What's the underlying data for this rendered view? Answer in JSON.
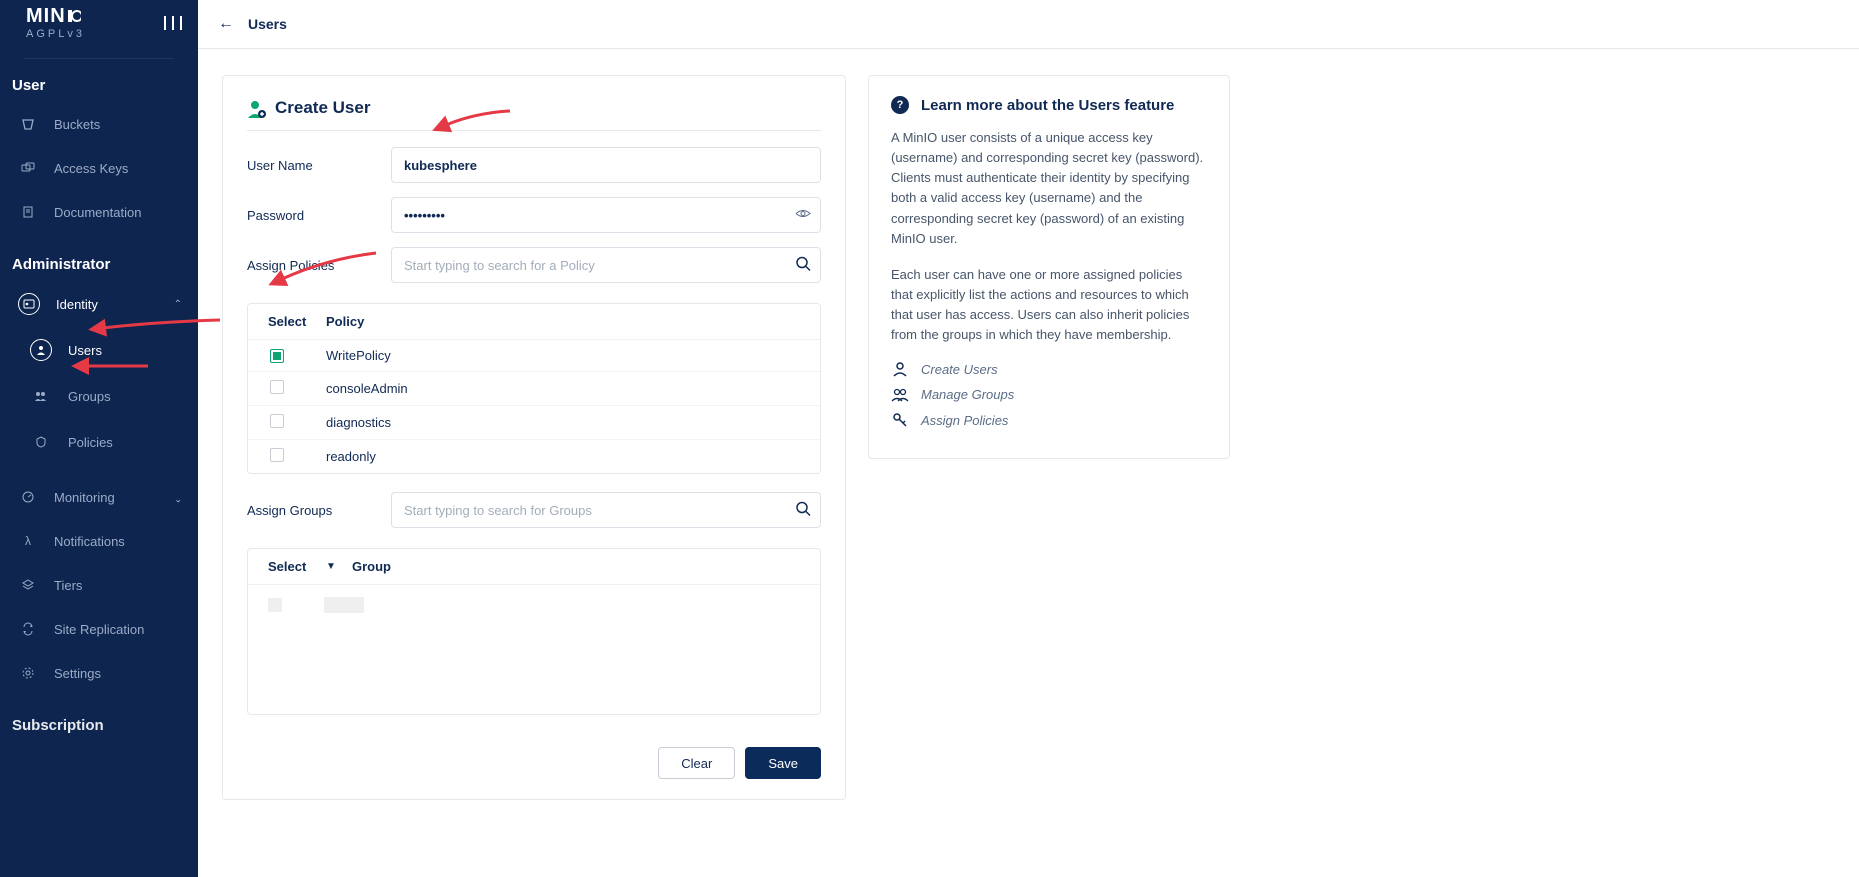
{
  "brand": {
    "name": "MINIO",
    "sub": "AGPLv3"
  },
  "sidebar": {
    "sections": [
      {
        "title": "User",
        "items": [
          {
            "label": "Buckets",
            "icon": "bucket-icon"
          },
          {
            "label": "Access Keys",
            "icon": "keys-icon"
          },
          {
            "label": "Documentation",
            "icon": "doc-icon"
          }
        ]
      },
      {
        "title": "Administrator",
        "items": [
          {
            "label": "Identity",
            "icon": "identity-icon",
            "expandable": true,
            "expanded": true,
            "children": [
              {
                "label": "Users",
                "active": true,
                "icon": "user-icon"
              },
              {
                "label": "Groups",
                "icon": "groups-icon"
              },
              {
                "label": "Policies",
                "icon": "policies-icon"
              }
            ]
          },
          {
            "label": "Monitoring",
            "icon": "monitor-icon",
            "expandable": true,
            "expanded": false
          },
          {
            "label": "Notifications",
            "icon": "lambda-icon"
          },
          {
            "label": "Tiers",
            "icon": "tiers-icon"
          },
          {
            "label": "Site Replication",
            "icon": "replication-icon"
          },
          {
            "label": "Settings",
            "icon": "gear-icon"
          }
        ]
      },
      {
        "title": "Subscription",
        "items": []
      }
    ]
  },
  "topbar": {
    "breadcrumb": "Users"
  },
  "form": {
    "title": "Create User",
    "labels": {
      "username": "User Name",
      "password": "Password",
      "assign_policies": "Assign Policies",
      "assign_groups": "Assign Groups"
    },
    "values": {
      "username": "kubesphere",
      "password": "•••••••••"
    },
    "placeholders": {
      "policy_search": "Start typing to search for a Policy",
      "group_search": "Start typing to search for Groups"
    },
    "policy_table": {
      "headers": {
        "select": "Select",
        "policy": "Policy"
      },
      "rows": [
        {
          "name": "WritePolicy",
          "checked": true
        },
        {
          "name": "consoleAdmin",
          "checked": false
        },
        {
          "name": "diagnostics",
          "checked": false
        },
        {
          "name": "readonly",
          "checked": false
        }
      ]
    },
    "group_table": {
      "headers": {
        "select": "Select",
        "group": "Group"
      }
    },
    "buttons": {
      "clear": "Clear",
      "save": "Save"
    }
  },
  "info": {
    "title": "Learn more about the Users feature",
    "p1": "A MinIO user consists of a unique access key (username) and corresponding secret key (password). Clients must authenticate their identity by specifying both a valid access key (username) and the corresponding secret key (password) of an existing MinIO user.",
    "p2": "Each user can have one or more assigned policies that explicitly list the actions and resources to which that user has access. Users can also inherit policies from the groups in which they have membership.",
    "links": {
      "create_users": "Create Users",
      "manage_groups": "Manage Groups",
      "assign_policies": "Assign Policies"
    }
  }
}
